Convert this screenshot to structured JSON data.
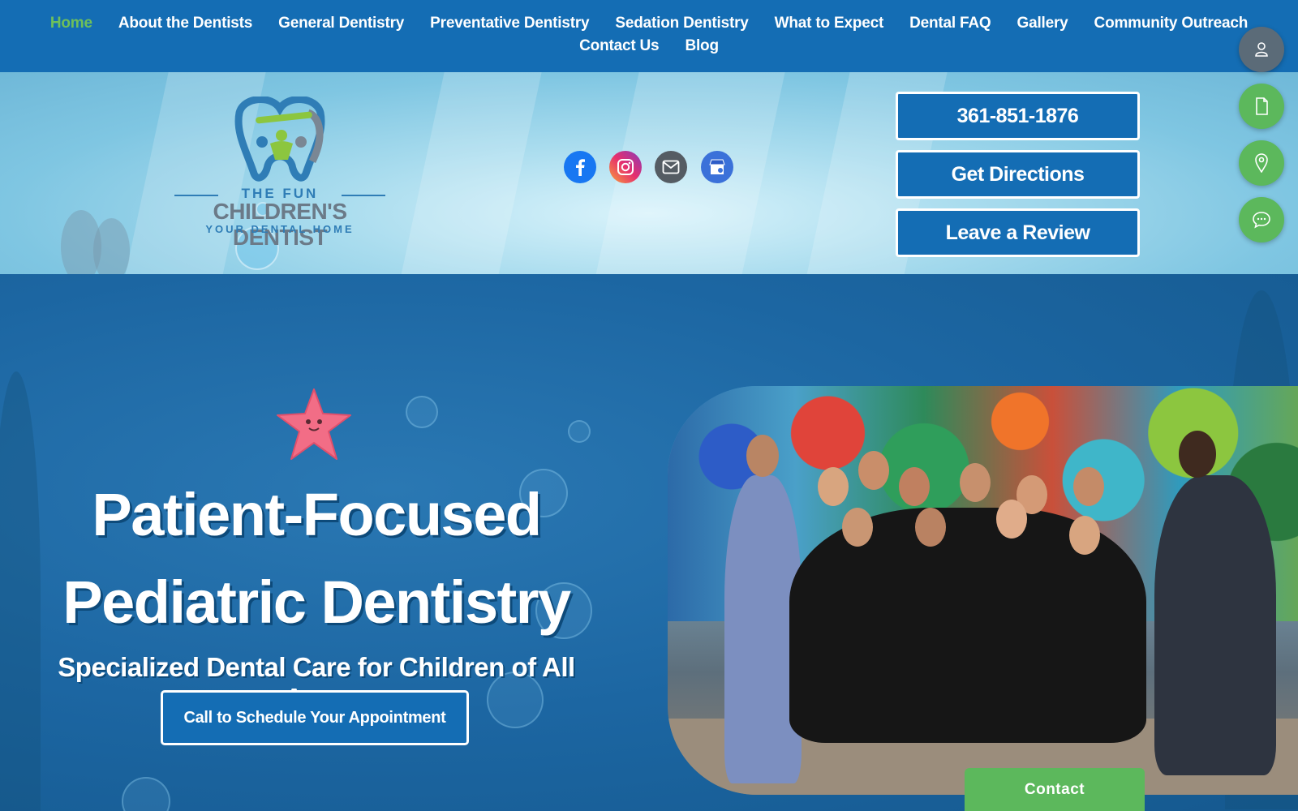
{
  "nav": {
    "row1": [
      {
        "label": "Home",
        "name": "nav-home"
      },
      {
        "label": "About the Dentists",
        "name": "nav-about-dentists"
      },
      {
        "label": "General Dentistry",
        "name": "nav-general-dentistry"
      },
      {
        "label": "Preventative Dentistry",
        "name": "nav-preventative-dentistry"
      },
      {
        "label": "Sedation Dentistry",
        "name": "nav-sedation-dentistry"
      },
      {
        "label": "What to Expect",
        "name": "nav-what-to-expect"
      },
      {
        "label": "Dental FAQ",
        "name": "nav-dental-faq"
      },
      {
        "label": "Gallery",
        "name": "nav-gallery"
      },
      {
        "label": "Community Outreach",
        "name": "nav-community-outreach"
      }
    ],
    "row2": [
      {
        "label": "Contact Us",
        "name": "nav-contact-us"
      },
      {
        "label": "Blog",
        "name": "nav-blog"
      }
    ],
    "active": "Home"
  },
  "logo": {
    "line1": "THE FUN",
    "line2": "CHILDREN'S DENTIST",
    "line3": "YOUR DENTAL HOME"
  },
  "social": [
    {
      "name": "facebook-icon"
    },
    {
      "name": "instagram-icon"
    },
    {
      "name": "email-icon"
    },
    {
      "name": "google-business-icon"
    }
  ],
  "header_buttons": {
    "phone": "361-851-1876",
    "directions": "Get Directions",
    "review": "Leave a Review"
  },
  "floating": [
    {
      "name": "account-icon"
    },
    {
      "name": "document-icon"
    },
    {
      "name": "location-pin-icon"
    },
    {
      "name": "chat-icon"
    }
  ],
  "hero": {
    "title_line1": "Patient-Focused",
    "title_line2": "Pediatric Dentistry",
    "subtitle": "Specialized Dental Care for Children of All Ages",
    "cta": "Call to Schedule Your Appointment"
  },
  "contact_tab": "Contact",
  "colors": {
    "nav_bg": "#146db4",
    "nav_active": "#6ec05a",
    "accent_green": "#5cb85c",
    "hero_bg": "#1c66a2"
  }
}
